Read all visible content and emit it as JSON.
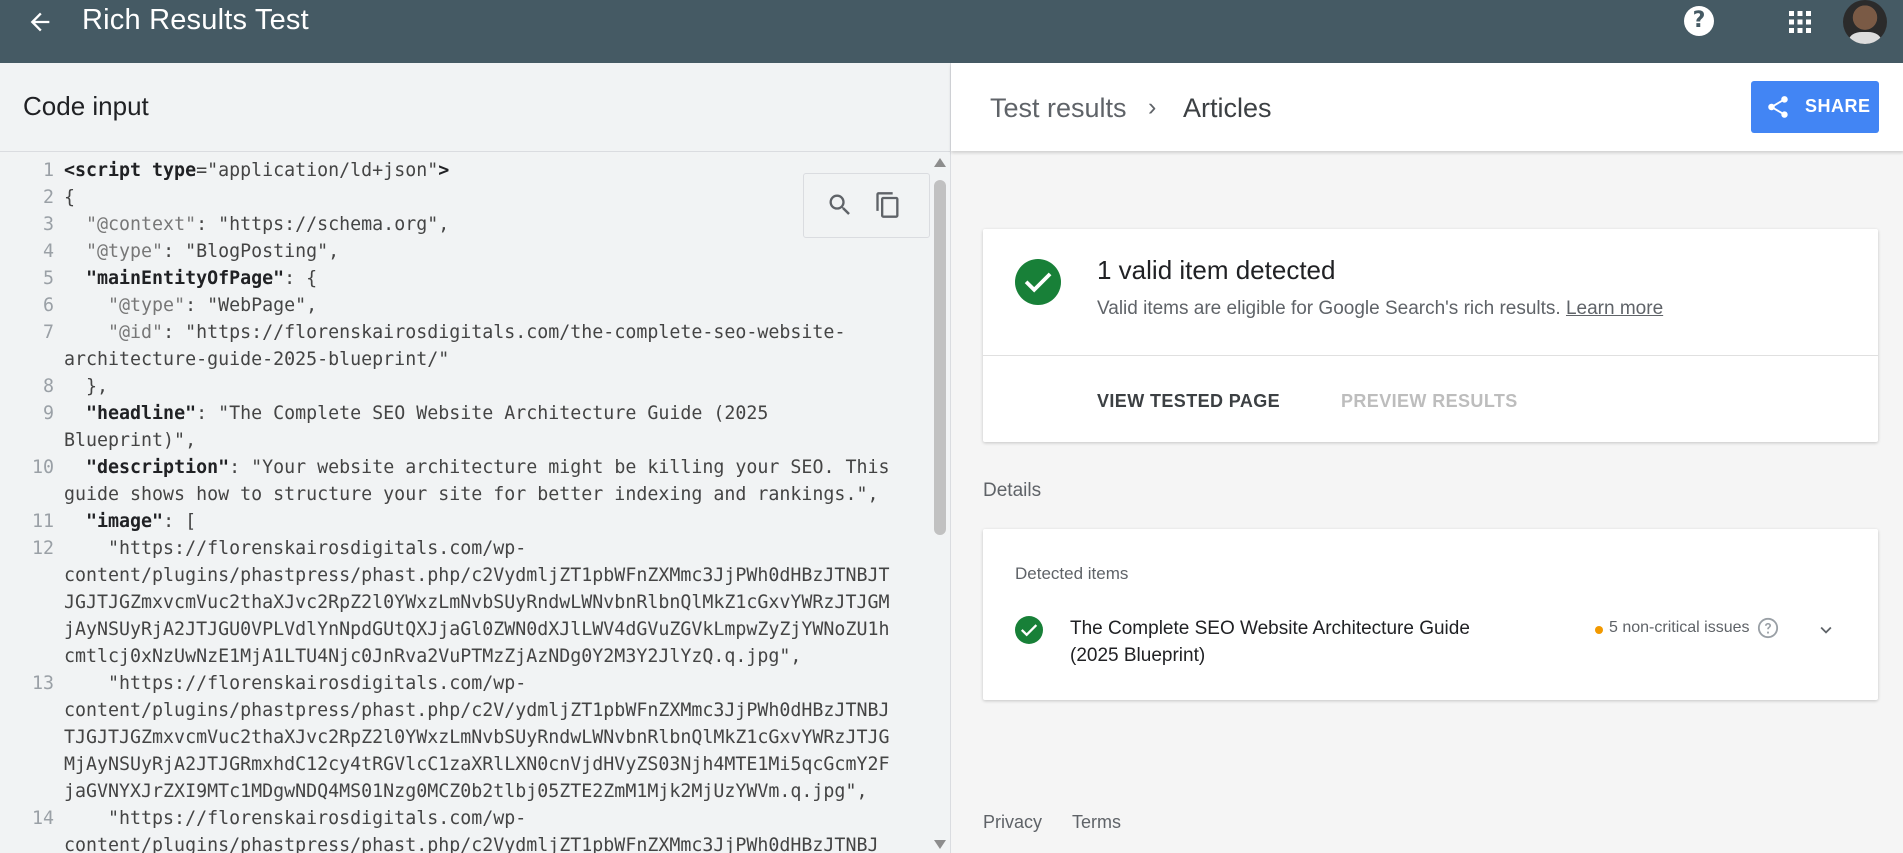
{
  "app": {
    "title": "Rich Results Test",
    "help_label": "?"
  },
  "code_panel": {
    "title": "Code input",
    "lines": [
      {
        "n": "1",
        "html": "<span class='tag'>&lt;script type</span>=\"application/ld+json\"<span class='tag'>&gt;</span>"
      },
      {
        "n": "2",
        "html": "{"
      },
      {
        "n": "3",
        "html": "  <span class='ki'>\"@context\"</span>: \"https://schema.org\","
      },
      {
        "n": "4",
        "html": "  <span class='ki'>\"@type\"</span>: \"BlogPosting\","
      },
      {
        "n": "5",
        "html": "  <span class='k'>\"mainEntityOfPage\"</span>: {"
      },
      {
        "n": "6",
        "html": "    <span class='ki'>\"@type\"</span>: \"WebPage\","
      },
      {
        "n": "7",
        "html": "    <span class='ki'>\"@id\"</span>: \"https://florenskairosdigitals.com/the-complete-seo-website-"
      },
      {
        "n": "",
        "html": "architecture-guide-2025-blueprint/\""
      },
      {
        "n": "8",
        "html": "  },"
      },
      {
        "n": "9",
        "html": "  <span class='k'>\"headline\"</span>: \"The Complete SEO Website Architecture Guide (2025"
      },
      {
        "n": "",
        "html": "Blueprint)\","
      },
      {
        "n": "10",
        "html": "  <span class='k'>\"description\"</span>: \"Your website architecture might be killing your SEO. This"
      },
      {
        "n": "",
        "html": "guide shows how to structure your site for better indexing and rankings.\","
      },
      {
        "n": "11",
        "html": "  <span class='k'>\"image\"</span>: ["
      },
      {
        "n": "12",
        "html": "    \"https://florenskairosdigitals.com/wp-"
      },
      {
        "n": "",
        "html": "content/plugins/phastpress/phast.php/c2VydmljZT1pbWFnZXMmc3JjPWh0dHBzJTNBJT"
      },
      {
        "n": "",
        "html": "JGJTJGZmxvcmVuc2thaXJvc2RpZ2l0YWxzLmNvbSUyRndwLWNvbnRlbnQlMkZ1cGxvYWRzJTJGM"
      },
      {
        "n": "",
        "html": "jAyNSUyRjA2JTJGU0VPLVdlYnNpdGUtQXJjaGl0ZWN0dXJlLWV4dGVuZGVkLmpwZyZjYWNoZU1h"
      },
      {
        "n": "",
        "html": "cmtlcj0xNzUwNzE1MjA1LTU4Njc0JnRva2VuPTMzZjAzNDg0Y2M3Y2JlYzQ.q.jpg\","
      },
      {
        "n": "13",
        "html": "    \"https://florenskairosdigitals.com/wp-"
      },
      {
        "n": "",
        "html": "content/plugins/phastpress/phast.php/c2V/ydmljZT1pbWFnZXMmc3JjPWh0dHBzJTNBJ"
      },
      {
        "n": "",
        "html": "TJGJTJGZmxvcmVuc2thaXJvc2RpZ2l0YWxzLmNvbSUyRndwLWNvbnRlbnQlMkZ1cGxvYWRzJTJG"
      },
      {
        "n": "",
        "html": "MjAyNSUyRjA2JTJGRmxhdC12cy4tRGVlcC1zaXRlLXN0cnVjdHVyZS03Njh4MTE1Mi5qcGcmY2F"
      },
      {
        "n": "",
        "html": "jaGVNYXJrZXI9MTc1MDgwNDQ4MS01Nzg0MCZ0b2tlbj05ZTE2ZmM1Mjk2MjUzYWVm.q.jpg\","
      },
      {
        "n": "14",
        "html": "    \"https://florenskairosdigitals.com/wp-"
      },
      {
        "n": "",
        "html": "content/plugins/phastpress/phast.php/c2VydmljZT1pbWFnZXMmc3JjPWh0dHBzJTNBJ"
      }
    ]
  },
  "results_panel": {
    "breadcrumb": [
      "Test results",
      "Articles"
    ],
    "breadcrumb_sep": "›",
    "share_label": "SHARE",
    "summary": {
      "title": "1 valid item detected",
      "subtitle": "Valid items are eligible for Google Search's rich results.",
      "learn_more": "Learn more",
      "view_tested_page": "VIEW TESTED PAGE",
      "preview_results": "PREVIEW RESULTS"
    },
    "details_label": "Details",
    "detected": {
      "label": "Detected items",
      "item_title": "The Complete SEO Website Architecture Guide (2025 Blueprint)",
      "issues": "5 non-critical issues"
    },
    "footer": {
      "privacy": "Privacy",
      "terms": "Terms"
    }
  },
  "colors": {
    "topbar": "#455a64",
    "share": "#4285f4",
    "valid_green": "#188038",
    "warning": "#f29900"
  },
  "icons": [
    "back-arrow-icon",
    "help-icon",
    "apps-grid-icon",
    "search-icon",
    "copy-icon",
    "share-icon",
    "check-circle-icon",
    "help-outline-icon",
    "chevron-down-icon"
  ]
}
